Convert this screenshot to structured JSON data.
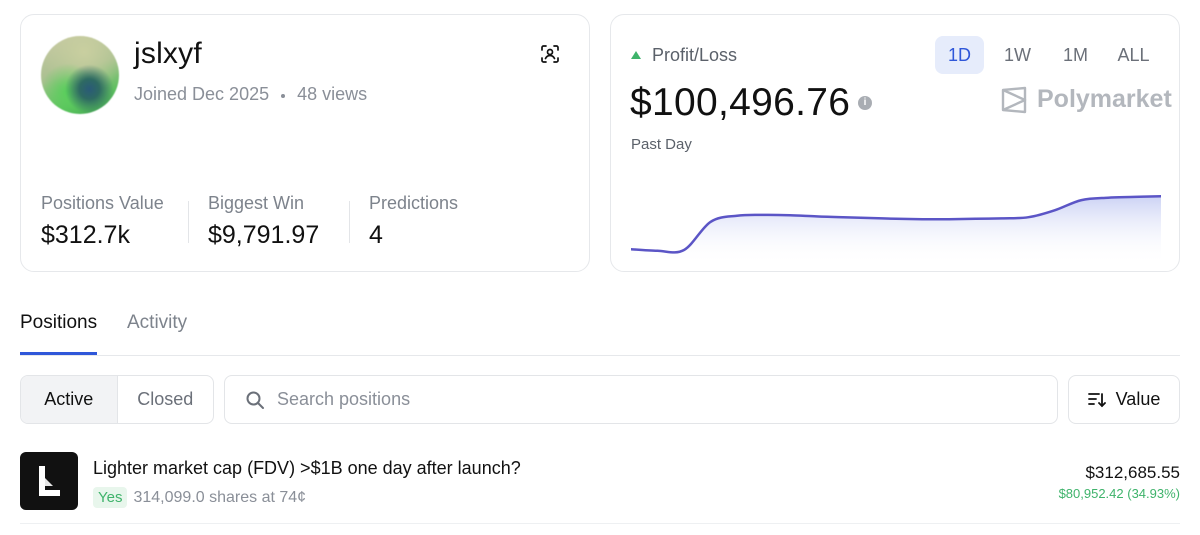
{
  "profile": {
    "username": "jslxyf",
    "joined": "Joined Dec 2025",
    "views": "48 views",
    "stats": [
      {
        "label": "Positions Value",
        "value": "$312.7k"
      },
      {
        "label": "Biggest Win",
        "value": "$9,791.97"
      },
      {
        "label": "Predictions",
        "value": "4"
      }
    ]
  },
  "pnl": {
    "label": "Profit/Loss",
    "value": "$100,496.76",
    "period_label": "Past Day",
    "ranges": [
      "1D",
      "1W",
      "1M",
      "ALL"
    ],
    "active_range": "1D",
    "brand": "Polymarket"
  },
  "chart_data": {
    "type": "area",
    "x": [
      0,
      1,
      2,
      3,
      4,
      5,
      6,
      7,
      8,
      9,
      10,
      11,
      12,
      13,
      14,
      15,
      16,
      17,
      18,
      19,
      20
    ],
    "values": [
      10,
      8,
      9,
      45,
      53,
      54,
      53.5,
      52,
      51,
      50,
      49,
      48.5,
      48.5,
      49,
      49.5,
      51,
      60,
      73,
      76,
      77,
      78
    ],
    "ylim": [
      0,
      100
    ],
    "line_color": "#5b55c6",
    "fill_color": "#dfe3f8"
  },
  "tabs": [
    "Positions",
    "Activity"
  ],
  "active_tab": "Positions",
  "filters": {
    "segments": [
      "Active",
      "Closed"
    ],
    "active_segment": "Active",
    "search_placeholder": "Search positions",
    "sort_label": "Value"
  },
  "positions": [
    {
      "title": "Lighter market cap (FDV) >$1B one day after launch?",
      "outcome": "Yes",
      "shares": "314,099.0 shares at 74¢",
      "value": "$312,685.55",
      "pnl": "$80,952.42 (34.93%)"
    }
  ],
  "colors": {
    "accent": "#2f57d9",
    "positive": "#3fb36b"
  }
}
